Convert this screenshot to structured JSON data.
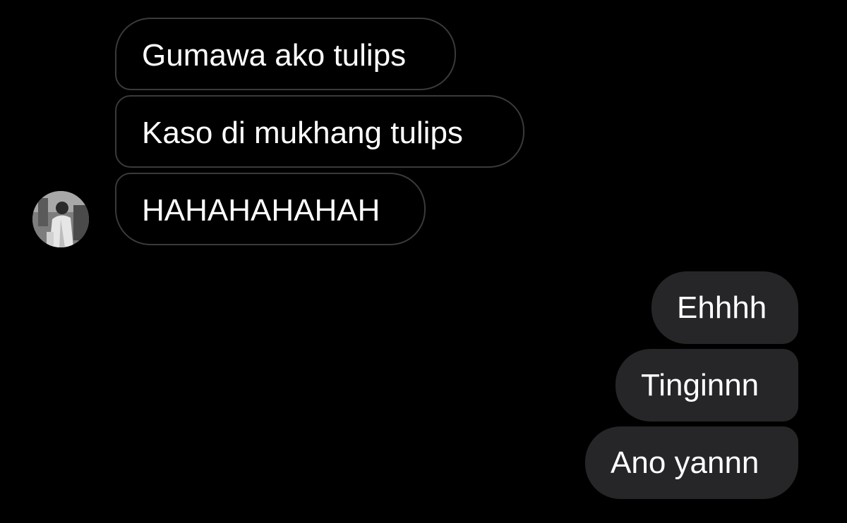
{
  "conversation": {
    "received": [
      {
        "text": "Gumawa ako tulips"
      },
      {
        "text": "Kaso di mukhang tulips"
      },
      {
        "text": "HAHAHAHAHAH"
      }
    ],
    "sent": [
      {
        "text": "Ehhhh"
      },
      {
        "text": "Tinginnn"
      },
      {
        "text": "Ano yannn"
      }
    ]
  },
  "contact": {
    "avatar_icon": "profile-photo-icon"
  },
  "colors": {
    "background": "#000000",
    "received_border": "#3a3a3c",
    "sent_bubble": "#262628",
    "text": "#ffffff"
  }
}
